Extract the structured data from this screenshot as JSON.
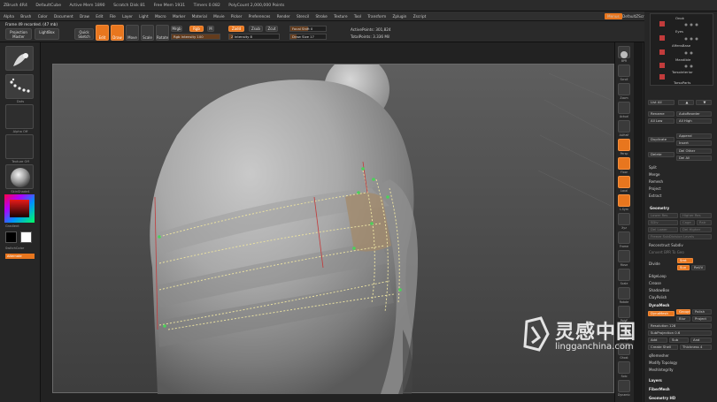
{
  "titlebar": {
    "items": [
      "ZBrush 4R4",
      "DefaultCube",
      "Active Mem 1890",
      "Scratch Disk 81",
      "Free Mem 1931",
      "Timers 0.082",
      "PolyCount 2,000,000 Points"
    ]
  },
  "menubar": {
    "items": [
      "Alpha",
      "Brush",
      "Color",
      "Document",
      "Draw",
      "Edit",
      "File",
      "Layer",
      "Light",
      "Macro",
      "Marker",
      "Material",
      "Movie",
      "Picker",
      "Preferences",
      "Render",
      "Stencil",
      "Stroke",
      "Texture",
      "Tool",
      "Transform",
      "Zplugin",
      "Zscript"
    ],
    "menus_tag": "Menus",
    "script_label": "DefaultZScript"
  },
  "toolbar": {
    "status": "Frame 49 recorded. (47 mb)",
    "projection_master": "Projection Master",
    "lightbox": "LightBox",
    "quick_sketch": "Quick Sketch",
    "edit": "Edit",
    "draw": "Draw",
    "move": "Move",
    "scale": "Scale",
    "rotate": "Rotate",
    "mrgb": "Mrgb",
    "rgb": "Rgb",
    "m": "M",
    "rgb_intensity": "Rgb Intensity 100",
    "zadd": "Zadd",
    "zsub": "Zsub",
    "z_intensity": "Z Intensity 8",
    "zcut": "Zcut",
    "focal_shift": "Focal Shift 0",
    "draw_size": "Draw Size 17",
    "active_points": "ActivePoints: 301,824",
    "total_points": "TotalPoints: 3.336 Mil"
  },
  "leftpanel": {
    "captions": [
      "",
      "Dots",
      "Alpha Off",
      "Texture Off",
      "SkinShade4",
      "Gradient",
      "SwitchColor",
      "Alternate"
    ]
  },
  "righticons": {
    "captions": [
      "BPR",
      "Scroll",
      "Zoom",
      "Actual",
      "AAHalf",
      "Persp",
      "Floor",
      "Local",
      "L.Sym",
      "Xyz",
      "",
      "",
      "Frame",
      "Move",
      "Scale",
      "Rotate",
      "PolyF",
      "Transp",
      "Ghost",
      "Solo",
      "Dynamic"
    ]
  },
  "subtool": {
    "items": [
      "Onok",
      "Eyes",
      "AffensBase",
      "Mandible",
      "Torsointerior",
      "TorsoParts"
    ],
    "list_all": "List All",
    "rename": "Rename",
    "autoreorder": "AutoReorder",
    "all_low": "All Low",
    "all_high": "All High",
    "duplicate": "Duplicate",
    "append": "Append",
    "insert": "Insert",
    "delete": "Delete",
    "del_other": "Del Other",
    "del_all": "Del All",
    "split": "Split",
    "merge": "Merge",
    "remesh": "Remesh",
    "project": "Project",
    "extract": "Extract",
    "geometry": "Geometry",
    "lower_res": "Lower Res",
    "higher_res": "Higher Res",
    "sdiv": "SDiv",
    "cage": "Cage",
    "rstr": "Rstr",
    "del_lower": "Del Lower",
    "del_higher": "Del Higher",
    "freeze": "Freeze SubDivision Levels",
    "reconstruct": "Reconstruct Subdiv",
    "convert_bpr": "Convert BPR To Geo",
    "divide": "Divide",
    "smt": "Smt",
    "suv": "Suv",
    "reuv": "ReUV",
    "edgeloop": "EdgeLoop",
    "crease": "Crease",
    "shadowbox": "ShadowBox",
    "claypolish": "ClayPolish",
    "dynamesh": "DynaMesh",
    "dynamesh_btn": "DynaMesh",
    "groups": "Groups",
    "polish": "Polish",
    "blur": "Blur",
    "project2": "Project",
    "resolution": "Resolution 128",
    "subproject": "SubProjection 0.6",
    "add": "Add",
    "sub": "Sub",
    "and": "And",
    "create_shell": "Create Shell",
    "thickness": "Thickness 4",
    "qremesher": "qRemesher",
    "modify_topology": "Modify Topology",
    "mesh_integrity": "MeshIntegrity",
    "layers": "Layers",
    "fibermesh": "FiberMesh",
    "geometry_hd": "Geometry HD"
  },
  "watermark": {
    "cn": "灵感中国",
    "url": "lingganchina.com"
  },
  "colors": {
    "accent": "#e8761e",
    "panel": "#262626",
    "canvas": "#555555"
  }
}
